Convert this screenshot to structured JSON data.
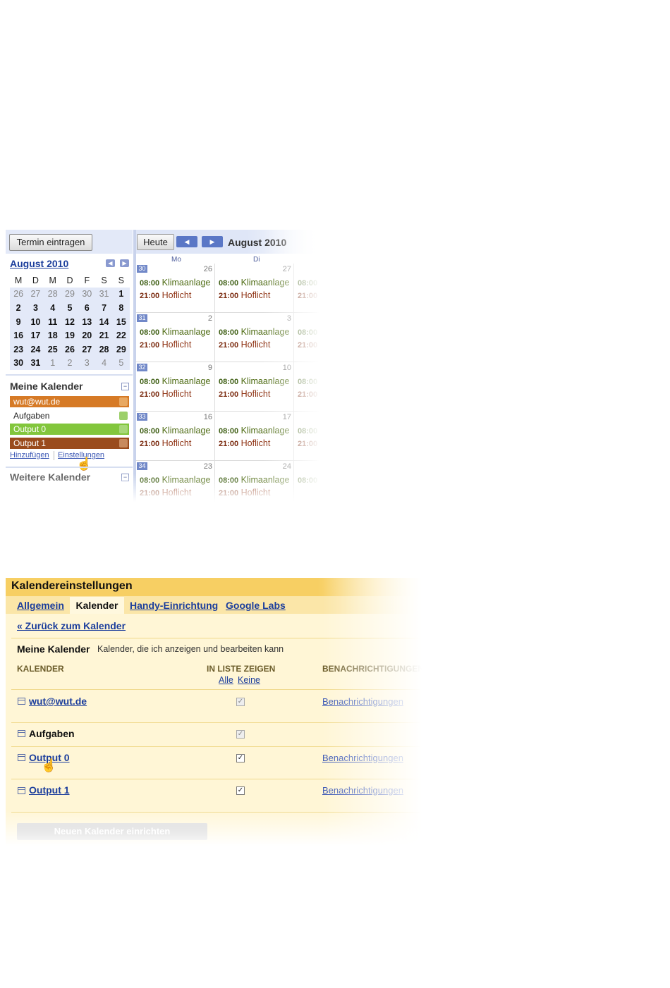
{
  "calendar": {
    "create_button": "Termin eintragen",
    "mini": {
      "month": "August 2010",
      "prev_icon": "arrow-left-icon",
      "next_icon": "arrow-right-icon",
      "weekdays": [
        "M",
        "D",
        "M",
        "D",
        "F",
        "S",
        "S"
      ],
      "weeks": [
        [
          "26",
          "27",
          "28",
          "29",
          "30",
          "31",
          "1"
        ],
        [
          "2",
          "3",
          "4",
          "5",
          "6",
          "7",
          "8"
        ],
        [
          "9",
          "10",
          "11",
          "12",
          "13",
          "14",
          "15"
        ],
        [
          "16",
          "17",
          "18",
          "19",
          "20",
          "21",
          "22"
        ],
        [
          "23",
          "24",
          "25",
          "26",
          "27",
          "28",
          "29"
        ],
        [
          "30",
          "31",
          "1",
          "2",
          "3",
          "4",
          "5"
        ]
      ]
    },
    "my_calendars": {
      "heading": "Meine Kalender",
      "items": [
        {
          "label": "wut@wut.de",
          "color": "#d67a26"
        },
        {
          "label": "Aufgaben",
          "color": "#ffffff"
        },
        {
          "label": "Output 0",
          "color": "#82c63c"
        },
        {
          "label": "Output 1",
          "color": "#9a4b1c"
        }
      ],
      "add_link": "Hinzufügen",
      "settings_link": "Einstellungen"
    },
    "other_calendars": {
      "heading": "Weitere Kalender"
    },
    "toolbar": {
      "today_button": "Heute",
      "prev_icon": "arrow-left-icon",
      "next_icon": "arrow-right-icon",
      "month": "August 2010"
    },
    "day_headers": [
      "Mo",
      "Di"
    ],
    "weeks": [
      {
        "week": "30",
        "days": [
          "26",
          "27"
        ]
      },
      {
        "week": "31",
        "days": [
          "2",
          "3"
        ]
      },
      {
        "week": "32",
        "days": [
          "9",
          "10"
        ]
      },
      {
        "week": "33",
        "days": [
          "16",
          "17"
        ]
      },
      {
        "week": "34",
        "days": [
          "23",
          "24"
        ]
      }
    ],
    "events": [
      {
        "time": "08:00",
        "title": "Klimaanlage",
        "color": "#4e6b13"
      },
      {
        "time": "21:00",
        "title": "Hoflicht",
        "color": "#8f3415"
      }
    ]
  },
  "settings": {
    "title": "Kalendereinstellungen",
    "tabs": [
      "Allgemein",
      "Kalender",
      "Handy-Einrichtung",
      "Google Labs"
    ],
    "active_tab": "Kalender",
    "back_link": "« Zurück zum Kalender",
    "section_title": "Meine Kalender",
    "section_subtitle": "Kalender, die ich anzeigen und bearbeiten kann",
    "columns": {
      "calendar": "KALENDER",
      "show_in_list": "IN LISTE ZEIGEN",
      "notifications": "BENACHRICHTIGUNGEN"
    },
    "select_all": "Alle",
    "select_none": "Keine",
    "rows": [
      {
        "name": "wut@wut.de",
        "notifications": "Benachrichtigungen"
      },
      {
        "name": "Aufgaben",
        "notifications": ""
      },
      {
        "name": "Output 0",
        "notifications": "Benachrichtigungen"
      },
      {
        "name": "Output 1",
        "notifications": "Benachrichtigungen"
      }
    ],
    "new_calendar_button": "Neuen Kalender einrichten"
  }
}
